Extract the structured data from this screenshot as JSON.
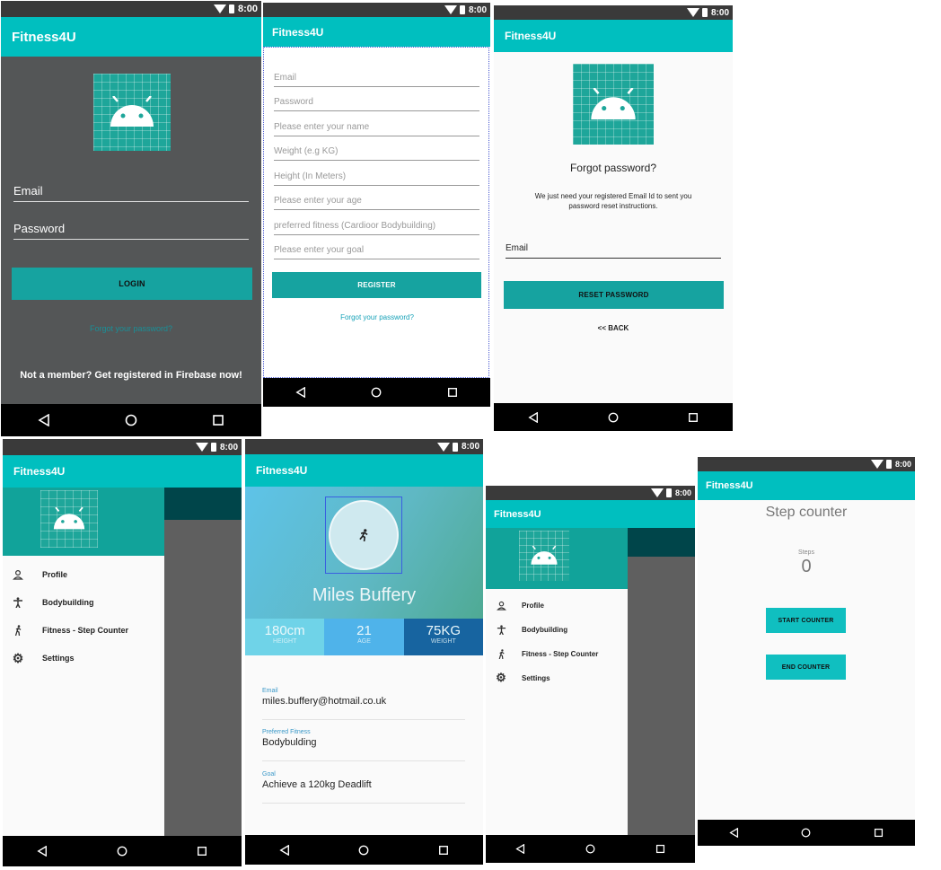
{
  "app_title": "Fitness4U",
  "status_time": "8:00",
  "login": {
    "email_label": "Email",
    "password_label": "Password",
    "login_button": "LOGIN",
    "forgot_link": "Forgot your password?",
    "register_text": "Not a member? Get registered in Firebase now!"
  },
  "register": {
    "fields": [
      "Email",
      "Password",
      "Please enter your name",
      "Weight (e.g KG)",
      "Height (In Meters)",
      "Please enter your age",
      "preferred fitness (Cardioor Bodybuilding)",
      "Please enter your goal"
    ],
    "register_button": "REGISTER",
    "forgot_link": "Forgot your password?"
  },
  "forgot": {
    "heading": "Forgot password?",
    "instructions": "We just need your registered Email Id to sent you password reset instructions.",
    "email_label": "Email",
    "reset_button": "RESET PASSWORD",
    "back_link": "<< BACK"
  },
  "drawer": {
    "items": [
      "Profile",
      "Bodybuilding",
      "Fitness - Step Counter",
      "Settings"
    ]
  },
  "profile": {
    "name": "Miles Buffery",
    "stats": [
      {
        "value": "180cm",
        "label": "HEIGHT"
      },
      {
        "value": "21",
        "label": "AGE"
      },
      {
        "value": "75KG",
        "label": "WEIGHT"
      }
    ],
    "details": [
      {
        "label": "Email",
        "value": "miles.buffery@hotmail.co.uk"
      },
      {
        "label": "Preferred Fitness",
        "value": "Bodybulding"
      },
      {
        "label": "Goal",
        "value": "Achieve a 120kg Deadlift"
      }
    ]
  },
  "steps": {
    "title": "Step counter",
    "steps_label": "Steps",
    "steps_value": "0",
    "start_button": "START COUNTER",
    "end_button": "END COUNTER"
  },
  "colors": {
    "accent": "#00bfbf",
    "button": "#16a3a0",
    "dark_bg": "#545657"
  }
}
